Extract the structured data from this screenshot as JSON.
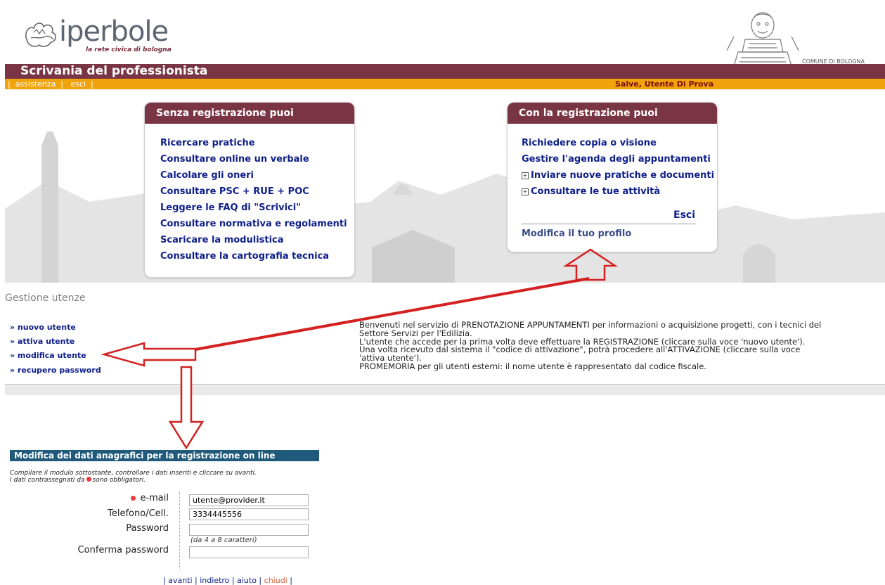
{
  "header": {
    "logo_word": "iperbole",
    "logo_tagline": "la rete civica di bologna",
    "crest_text": "COMUNE DI BOLOGNA",
    "app_title": "Scrivania del professionista",
    "nav": [
      "assistenza",
      "esci"
    ],
    "greeting": "Salve,  Utente Di Prova"
  },
  "panel_no_reg": {
    "title": "Senza registrazione puoi",
    "items": [
      "Ricercare pratiche",
      "Consultare online un verbale",
      "Calcolare gli oneri",
      "Consultare PSC + RUE + POC",
      "Leggere le FAQ di \"Scrivici\"",
      "Consultare normativa e regolamenti",
      "Scaricare la modulistica",
      "Consultare la cartografia tecnica"
    ]
  },
  "panel_reg": {
    "title": "Con la registrazione puoi",
    "items": [
      "Richiedere copia o visione",
      "Gestire l'agenda degli appuntamenti",
      "Inviare nuove pratiche e documenti",
      "Consultare le tue attività"
    ],
    "expand_symbol": "+",
    "logout": "Esci",
    "profile": "Modifica il tuo profilo"
  },
  "gestione": {
    "title": "Gestione utenze",
    "links": [
      "» nuovo utente",
      "» attiva utente",
      "» modifica utente",
      "» recupero password"
    ],
    "welcome_lines": [
      "Benvenuti nel servizio di PRENOTAZIONE APPUNTAMENTI per informazioni o acquisizione progetti, con i tecnici del",
      "Settore Servizi per l'Edilizia.",
      "L'utente che accede per la prima volta deve effettuare la REGISTRAZIONE (cliccare sulla voce 'nuovo utente').",
      "Una volta ricevuto dal sistema il \"codice di attivazione\", potrà procedere all'ATTIVAZIONE (cliccare sulla voce",
      "'attiva utente').",
      "PROMEMORIA per gli utenti esterni: il nome utente è rappresentato dal codice fiscale."
    ]
  },
  "form": {
    "title": "Modifica dei dati anagrafici per la registrazione on line",
    "intro_line1": "Compilare il modulo sottostante, controllare i dati inseriti e cliccare su avanti.",
    "intro_line2_a": "I dati contrassegnati da",
    "intro_line2_b": "sono obbligatori.",
    "email_label": "e-mail",
    "email_value": "utente@provider.it",
    "phone_label": "Telefono/Cell.",
    "phone_value": "3334445556",
    "password_label": "Password",
    "password_hint": "(da 4 a 8 caratteri)",
    "confirm_label": "Conferma password",
    "actions": [
      "avanti",
      "indietro",
      "aiuto",
      "chiudi"
    ]
  },
  "colors": {
    "brand_maroon": "#7a3545",
    "nav_orange": "#f0a30a",
    "link_blue": "#10208a",
    "annotation_red": "#d42020"
  }
}
